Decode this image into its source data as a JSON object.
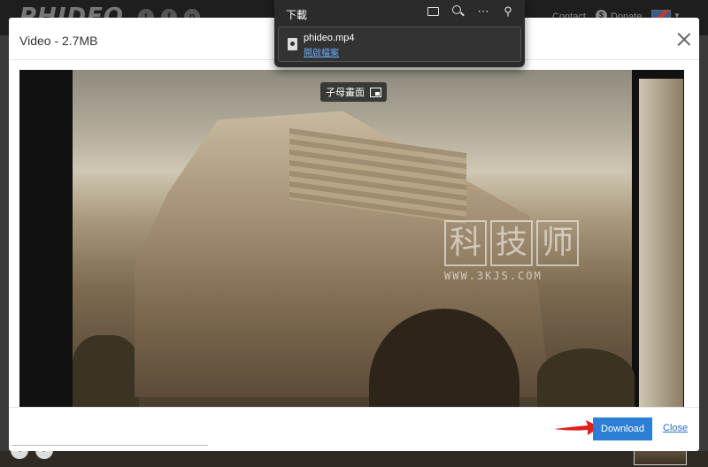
{
  "site": {
    "logo": "PHIDEO",
    "social": [
      "t",
      "f",
      "p"
    ],
    "contact": "Contact",
    "donate": "Donate",
    "donate_symbol": "$",
    "nav_prev": "‹",
    "nav_next": "›"
  },
  "modal": {
    "title": "Video - 2.7MB",
    "download_label": "Download",
    "close_label": "Close"
  },
  "video": {
    "pip_label": "子母畫面",
    "watermark_chars": [
      "科",
      "技",
      "师"
    ],
    "watermark_url": "WWW.3KJS.COM"
  },
  "downloads": {
    "title": "下載",
    "file_name": "phideo.mp4",
    "open_file": "開啟檔案"
  },
  "colors": {
    "download_button": "#2d7fd6",
    "arrow": "#e02020",
    "link": "#2a6fc4"
  }
}
